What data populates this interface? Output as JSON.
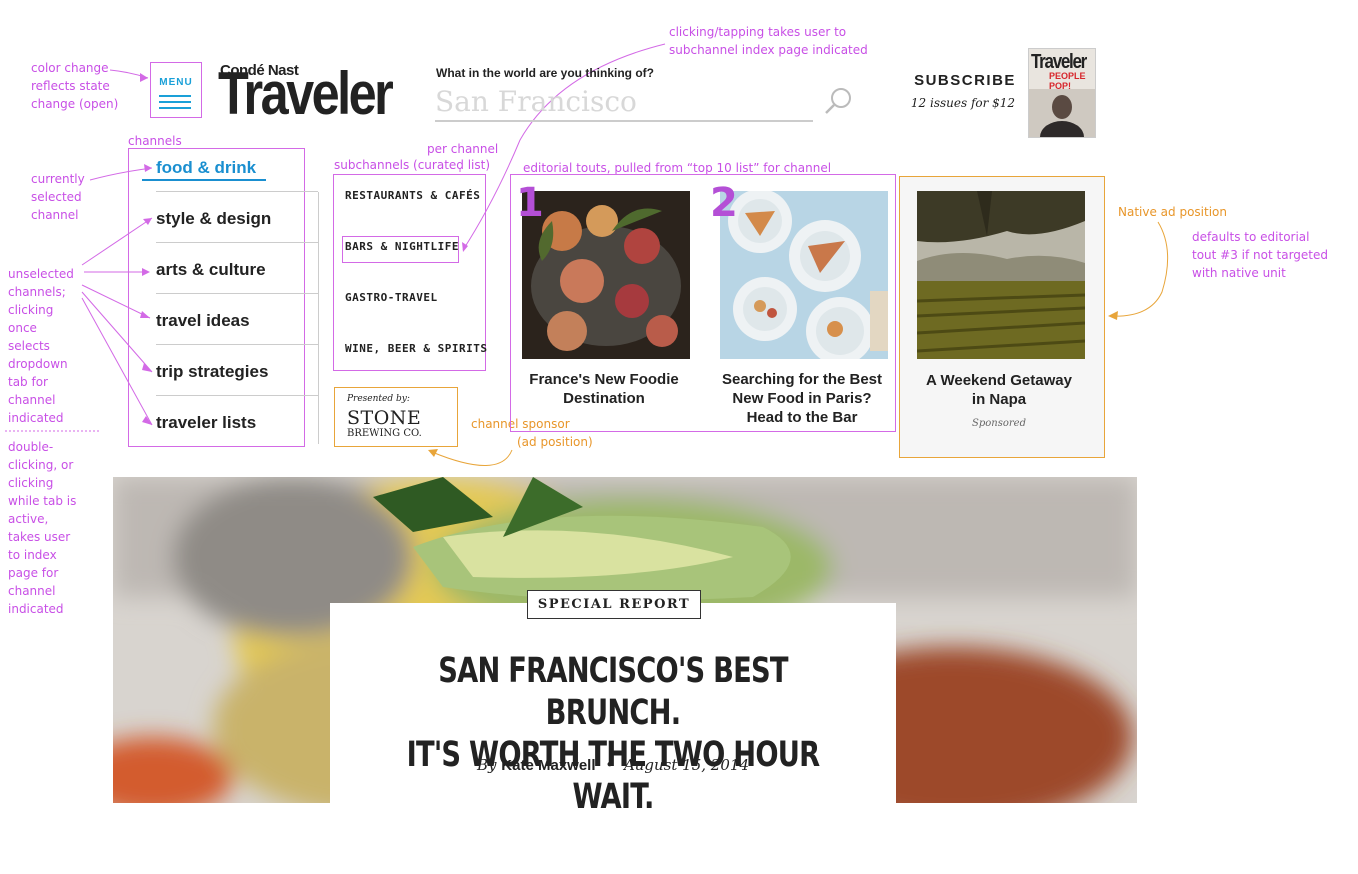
{
  "annotations": {
    "color_change": [
      "color change",
      "reflects state",
      "change (open)"
    ],
    "clicking_tap": [
      "clicking/tapping takes user to",
      "subchannel index page indicated"
    ],
    "channels": "channels",
    "per_channel": "per channel",
    "subchannels": "subchannels (curated list)",
    "editorial": "editorial touts, pulled from “top 10 list” for channel",
    "current": [
      "currently",
      "selected",
      "channel"
    ],
    "unselected": [
      "unselected",
      "channels;",
      "clicking",
      "once",
      "selects",
      "dropdown",
      "tab for",
      "channel",
      "indicated"
    ],
    "double": [
      "double-",
      "clicking, or",
      "clicking",
      "while tab is",
      "active,",
      "takes user",
      "to index",
      "page for",
      "channel",
      "indicated"
    ],
    "native": "Native ad position",
    "defaults": [
      "defaults to editorial",
      "tout #3 if not targeted",
      "with native unit"
    ],
    "sponsor": [
      "channel sponsor",
      "(ad position)"
    ]
  },
  "header": {
    "menu_label": "MENU",
    "logo_small": "Condé Nast",
    "logo_big": "Traveler",
    "search_question": "What in the world are you thinking of?",
    "search_placeholder": "San Francisco",
    "subscribe_title": "SUBSCRIBE",
    "subscribe_offer": "12 issues for $12",
    "mag_title": "Traveler",
    "mag_cover_line": "PEOPLE POP!"
  },
  "channels": [
    {
      "label": "food & drink",
      "selected": true
    },
    {
      "label": "style & design"
    },
    {
      "label": "arts & culture"
    },
    {
      "label": "travel ideas"
    },
    {
      "label": "trip strategies"
    },
    {
      "label": "traveler lists"
    }
  ],
  "subchannels": [
    "RESTAURANTS & CAFÉS",
    "BARS & NIGHTLIFE",
    "GASTRO-TRAVEL",
    "WINE, BEER & SPIRITS"
  ],
  "sponsor": {
    "presented_by": "Presented by:",
    "name_line1": "STONE",
    "name_line2": "BREWING CO."
  },
  "touts": [
    {
      "num": "1",
      "title_lines": [
        "France's New Foodie",
        "Destination"
      ]
    },
    {
      "num": "2",
      "title_lines": [
        "Searching for the Best",
        "New Food in Paris?",
        "Head to the Bar"
      ]
    }
  ],
  "native": {
    "title_lines": [
      "A Weekend Getaway",
      "in Napa"
    ],
    "label": "Sponsored"
  },
  "hero": {
    "badge": "SPECIAL REPORT",
    "headline_lines": [
      "SAN FRANCISCO'S BEST BRUNCH.",
      "IT'S WORTH THE TWO HOUR WAIT."
    ],
    "by": "By",
    "author": "Kate Maxwell",
    "sep": "•",
    "date": "August 15, 2014"
  },
  "colors": {
    "annotation": "#c84fe6",
    "ad_annotation": "#e8962a",
    "accent": "#1aa0d8"
  }
}
